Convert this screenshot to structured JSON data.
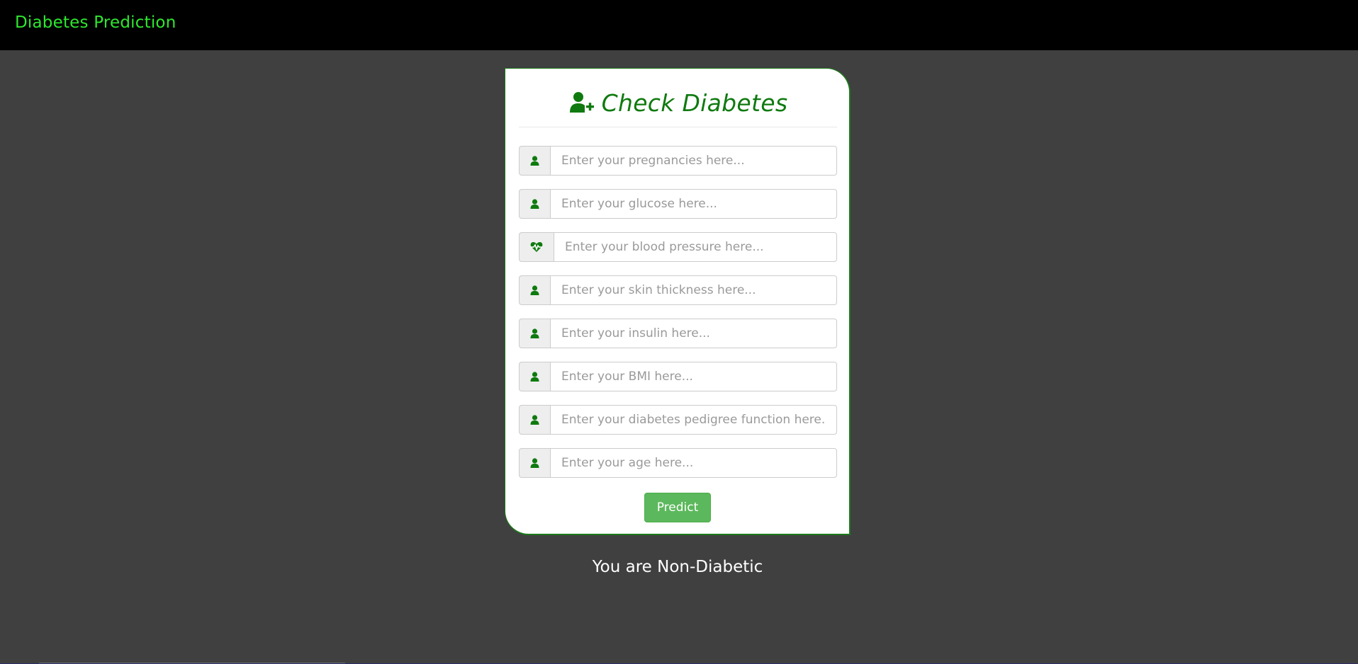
{
  "navbar": {
    "brand": "Diabetes Prediction",
    "brand_color": "#2ee82e"
  },
  "card": {
    "title": "Check Diabetes",
    "title_icon": "user-plus-icon",
    "accent_color": "#0f7a0f",
    "fields": [
      {
        "icon": "user-icon",
        "placeholder": "Enter your pregnancies here...",
        "value": ""
      },
      {
        "icon": "user-icon",
        "placeholder": "Enter your glucose here...",
        "value": ""
      },
      {
        "icon": "heartbeat-icon",
        "placeholder": "Enter your blood pressure here...",
        "value": ""
      },
      {
        "icon": "user-icon",
        "placeholder": "Enter your skin thickness here...",
        "value": ""
      },
      {
        "icon": "user-icon",
        "placeholder": "Enter your insulin here...",
        "value": ""
      },
      {
        "icon": "user-icon",
        "placeholder": "Enter your BMI here...",
        "value": ""
      },
      {
        "icon": "user-icon",
        "placeholder": "Enter your diabetes pedigree function here...",
        "value": ""
      },
      {
        "icon": "user-icon",
        "placeholder": "Enter your age here...",
        "value": ""
      }
    ],
    "submit_label": "Predict",
    "submit_color": "#5cb85c"
  },
  "result": {
    "text": "You are Non-Diabetic"
  }
}
